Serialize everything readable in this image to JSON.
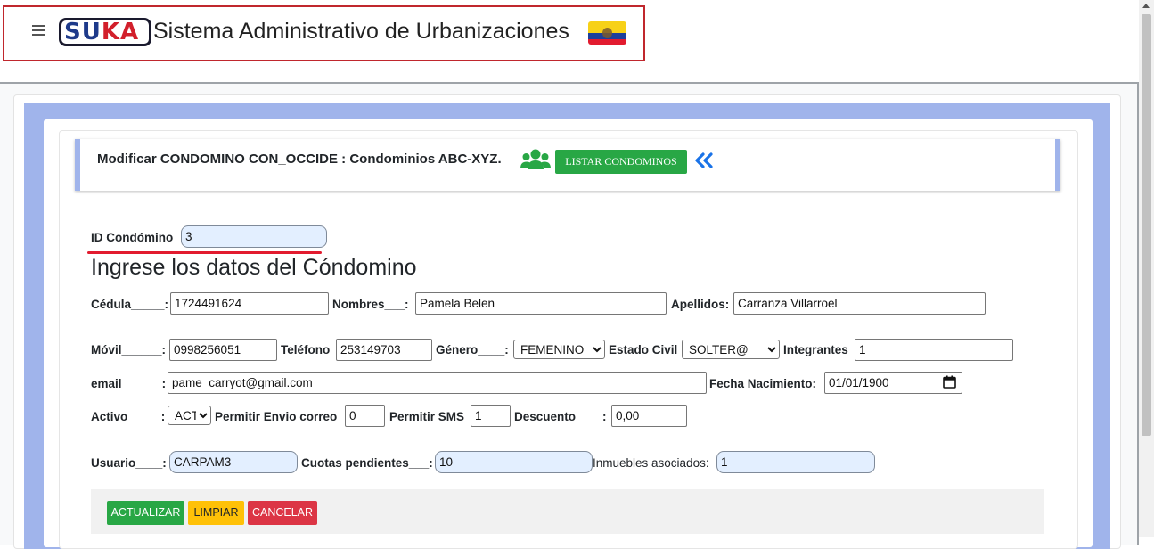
{
  "header": {
    "logo_text_blue": "SU",
    "logo_text_red": "KA",
    "title": "Sistema Administrativo de Urbanizaciones",
    "flag": "ecuador-flag-icon"
  },
  "title_bar": {
    "title": "Modificar CONDOMINO CON_OCCIDE : Condominios ABC-XYZ.",
    "list_button": "LISTAR CONDOMINOS",
    "icons": [
      "users-icon",
      "double-chevron-left-icon"
    ]
  },
  "form": {
    "id_label": "ID Condómino",
    "id_value": "3",
    "section_heading": "Ingrese los datos del Cóndomino",
    "cedula_label": "Cédula_____:",
    "cedula_value": "1724491624",
    "nombres_label": "Nombres___:",
    "nombres_value": "Pamela Belen",
    "apellidos_label": "Apellidos:",
    "apellidos_value": "Carranza Villarroel",
    "movil_label": "Móvil______:",
    "movil_value": "0998256051",
    "telefono_label": "Teléfono",
    "telefono_value": "253149703",
    "genero_label": "Género____:",
    "genero_value": "FEMENINO",
    "estado_civil_label": "Estado Civil",
    "estado_civil_value": "SOLTER@",
    "integrantes_label": "Integrantes",
    "integrantes_value": "1",
    "email_label": "email______:",
    "email_value": "pame_carryot@gmail.com",
    "fecha_label": "Fecha Nacimiento:",
    "fecha_value": "01/01/1900",
    "activo_label": "Activo_____:",
    "activo_value": "ACT",
    "envio_label": "Permitir Envio correo",
    "envio_value": "0",
    "sms_label": "Permitir SMS",
    "sms_value": "1",
    "descuento_label": "Descuento____:",
    "descuento_value": "0,00",
    "usuario_label": "Usuario____:",
    "usuario_value": "CARPAM3",
    "cuotas_label": "Cuotas pendientes___:",
    "cuotas_value": "10",
    "inmuebles_label": "Inmuebles asociados:",
    "inmuebles_value": "1"
  },
  "actions": {
    "actualizar": "ACTUALIZAR",
    "limpiar": "LIMPIAR",
    "cancelar": "CANCELAR"
  },
  "colors": {
    "accent_red": "#c0272d",
    "panel_blue": "#a0b4eb",
    "success": "#28a745",
    "warning": "#ffc107",
    "danger": "#dc3545"
  }
}
